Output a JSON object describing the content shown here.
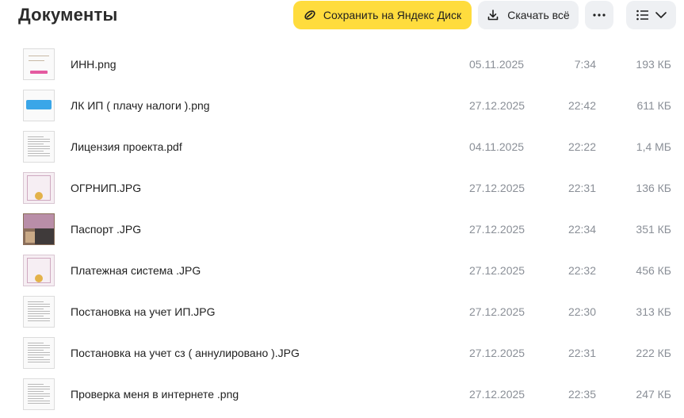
{
  "header": {
    "title": "Документы",
    "save_label": "Сохранить на Яндекс Диск",
    "download_label": "Скачать всё"
  },
  "colors": {
    "accent": "#ffdc3d",
    "button_bg": "#eef0f3",
    "meta_text": "#8a8f97"
  },
  "files": [
    {
      "name": "ИНН.png",
      "date": "05.11.2025",
      "time": "7:34",
      "size": "193 КБ",
      "thumb": "inn"
    },
    {
      "name": "ЛК ИП ( плачу налоги ).png",
      "date": "27.12.2025",
      "time": "22:42",
      "size": "611 КБ",
      "thumb": "blue"
    },
    {
      "name": "Лицензия проекта.pdf",
      "date": "04.11.2025",
      "time": "22:22",
      "size": "1,4 МБ",
      "thumb": "doc"
    },
    {
      "name": "ОГРНИП.JPG",
      "date": "27.12.2025",
      "time": "22:31",
      "size": "136 КБ",
      "thumb": "cert"
    },
    {
      "name": "Паспорт .JPG",
      "date": "27.12.2025",
      "time": "22:34",
      "size": "351 КБ",
      "thumb": "photo"
    },
    {
      "name": "Платежная система .JPG",
      "date": "27.12.2025",
      "time": "22:32",
      "size": "456 КБ",
      "thumb": "cert"
    },
    {
      "name": "Постановка на учет ИП.JPG",
      "date": "27.12.2025",
      "time": "22:30",
      "size": "313 КБ",
      "thumb": "doc"
    },
    {
      "name": "Постановка на учет сз ( аннулировано ).JPG",
      "date": "27.12.2025",
      "time": "22:31",
      "size": "222 КБ",
      "thumb": "doc"
    },
    {
      "name": "Проверка меня в интернете .png",
      "date": "27.12.2025",
      "time": "22:35",
      "size": "247 КБ",
      "thumb": "doc"
    }
  ]
}
